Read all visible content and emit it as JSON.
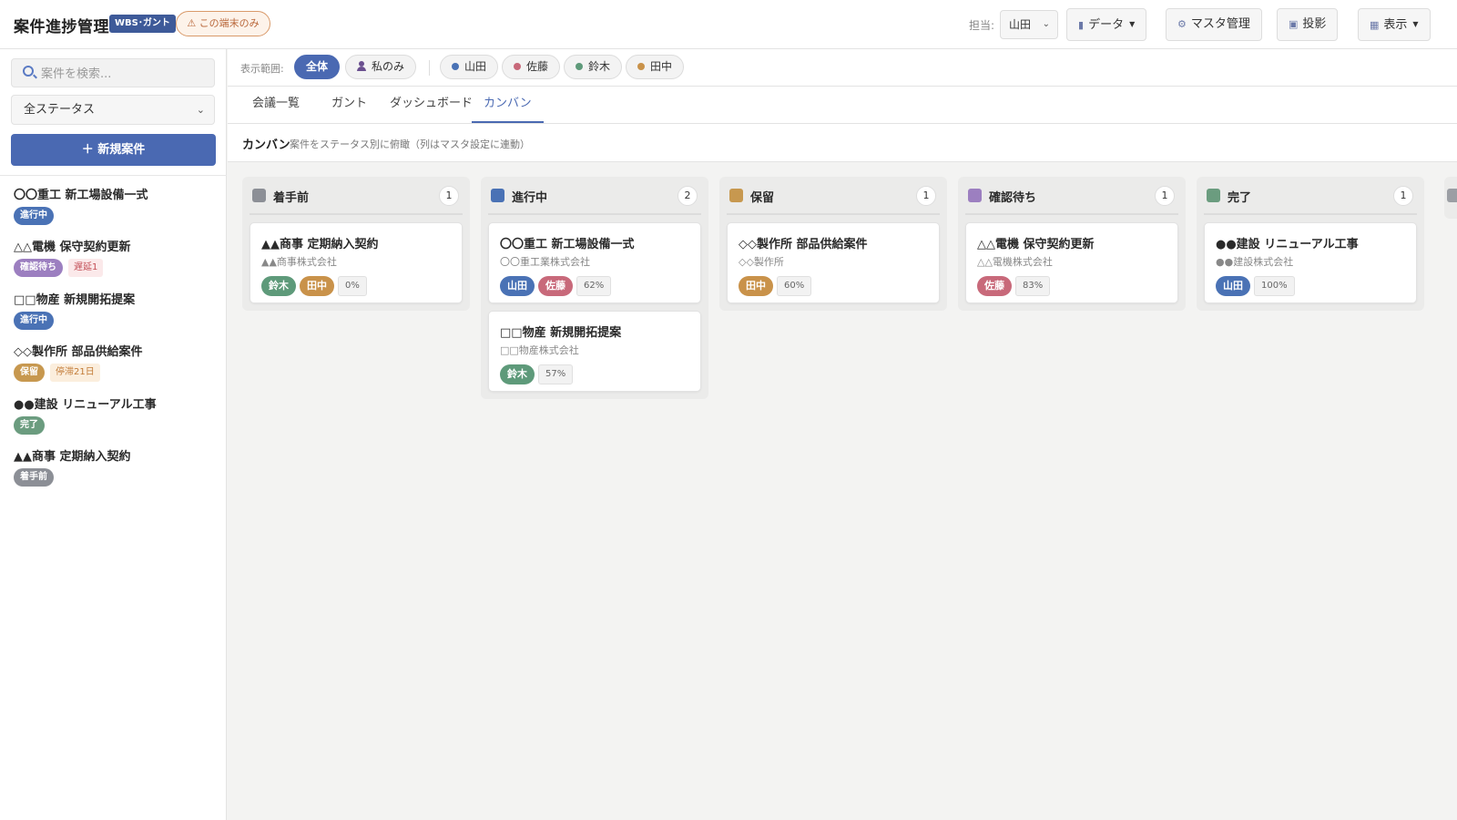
{
  "header": {
    "title": "案件進捗管理",
    "wbs_badge": "WBS･ガント",
    "local_badge": "⚠ この端末のみ",
    "assignee_label": "担当:",
    "assignee_value": "山田",
    "buttons": {
      "data": "データ",
      "master": "マスタ管理",
      "project": "投影",
      "view": "表示"
    }
  },
  "sidebar": {
    "search_placeholder": "案件を検索...",
    "status_filter": "全ステータス",
    "new_button": "＋ 新規案件",
    "projects": [
      {
        "name": "〇〇重工 新工場設備一式",
        "status": "進行中",
        "status_color": "#4a72b5",
        "warning": ""
      },
      {
        "name": "△△電機 保守契約更新",
        "status": "確認待ち",
        "status_color": "#9c7fc0",
        "warning": "遅延1"
      },
      {
        "name": "□□物産 新規開拓提案",
        "status": "進行中",
        "status_color": "#4a72b5",
        "warning": ""
      },
      {
        "name": "◇◇製作所 部品供給案件",
        "status": "保留",
        "status_color": "#c7984f",
        "warning": "停滞21日"
      },
      {
        "name": "●●建設 リニューアル工事",
        "status": "完了",
        "status_color": "#6b9c7f",
        "warning": ""
      },
      {
        "name": "▲▲商事 定期納入契約",
        "status": "着手前",
        "status_color": "#8c8f96",
        "warning": ""
      }
    ]
  },
  "filters": {
    "label": "表示範囲:",
    "all": "全体",
    "mine": "私のみ",
    "people": [
      {
        "name": "山田",
        "color": "#4a72b5"
      },
      {
        "name": "佐藤",
        "color": "#c8697a"
      },
      {
        "name": "鈴木",
        "color": "#5e9a7a"
      },
      {
        "name": "田中",
        "color": "#c9924a"
      }
    ]
  },
  "tabs": [
    "会議一覧",
    "ガント",
    "ダッシュボード",
    "カンバン"
  ],
  "active_tab": "カンバン",
  "section": {
    "title": "カンバン",
    "description": "案件をステータス別に俯瞰（列はマスタ設定に連動）"
  },
  "columns": [
    {
      "title": "着手前",
      "count": "1",
      "color": "#8c8f96",
      "cards": [
        {
          "title": "▲▲商事 定期納入契約",
          "company": "▲▲商事株式会社",
          "people": [
            "鈴木",
            "田中"
          ],
          "progress": "0%"
        }
      ]
    },
    {
      "title": "進行中",
      "count": "2",
      "color": "#4a72b5",
      "cards": [
        {
          "title": "〇〇重工 新工場設備一式",
          "company": "〇〇重工業株式会社",
          "people": [
            "山田",
            "佐藤"
          ],
          "progress": "62%"
        },
        {
          "title": "□□物産 新規開拓提案",
          "company": "□□物産株式会社",
          "people": [
            "鈴木"
          ],
          "progress": "57%"
        }
      ]
    },
    {
      "title": "保留",
      "count": "1",
      "color": "#c7984f",
      "cards": [
        {
          "title": "◇◇製作所 部品供給案件",
          "company": "◇◇製作所",
          "people": [
            "田中"
          ],
          "progress": "60%"
        }
      ]
    },
    {
      "title": "確認待ち",
      "count": "1",
      "color": "#9c7fc0",
      "cards": [
        {
          "title": "△△電機 保守契約更新",
          "company": "△△電機株式会社",
          "people": [
            "佐藤"
          ],
          "progress": "83%"
        }
      ]
    },
    {
      "title": "完了",
      "count": "1",
      "color": "#6b9c7f",
      "cards": [
        {
          "title": "●●建設 リニューアル工事",
          "company": "●●建設株式会社",
          "people": [
            "山田"
          ],
          "progress": "100%"
        }
      ]
    }
  ],
  "person_colors": {
    "山田": "#4a72b5",
    "佐藤": "#c8697a",
    "鈴木": "#5e9a7a",
    "田中": "#c9924a"
  }
}
